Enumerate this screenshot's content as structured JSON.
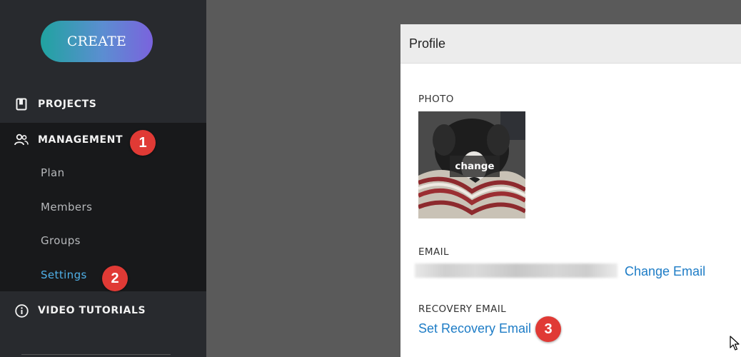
{
  "sidebar": {
    "create_label": "CREATE",
    "projects_label": "PROJECTS",
    "management_label": "MANAGEMENT",
    "sub_items": [
      "Plan",
      "Members",
      "Groups",
      "Settings"
    ],
    "video_label": "VIDEO TUTORIALS"
  },
  "badges": [
    "1",
    "2",
    "3"
  ],
  "profile": {
    "title": "Profile",
    "photo_label": "PHOTO",
    "photo_change": "change",
    "email_label": "EMAIL",
    "change_email": "Change Email",
    "recovery_label": "RECOVERY EMAIL",
    "set_recovery": "Set Recovery Email"
  },
  "colors": {
    "sidebar_bg": "#282a2e",
    "active_block_bg": "#18191b",
    "active_sub_item": "#4fb0e8",
    "badge": "#e03a35",
    "link": "#1d7cc6"
  },
  "icons": [
    "projects-icon",
    "management-icon",
    "info-icon",
    "cursor-icon"
  ]
}
